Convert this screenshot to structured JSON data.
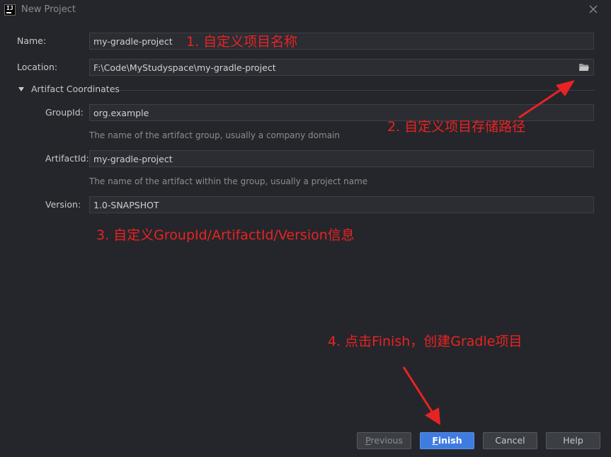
{
  "window": {
    "title": "New Project",
    "app_icon_text": "IJ"
  },
  "form": {
    "name_label": "Name:",
    "name_value": "my-gradle-project",
    "location_label": "Location:",
    "location_value": "F:\\Code\\MyStudyspace\\my-gradle-project",
    "section_title": "Artifact Coordinates",
    "groupid_label": "GroupId:",
    "groupid_value": "org.example",
    "groupid_hint": "The name of the artifact group, usually a company domain",
    "artifactid_label": "ArtifactId:",
    "artifactid_value": "my-gradle-project",
    "artifactid_hint": "The name of the artifact within the group, usually a project name",
    "version_label": "Version:",
    "version_value": "1.0-SNAPSHOT"
  },
  "annotations": {
    "a1": "1. 自定义项目名称",
    "a2": "2. 自定义项目存储路径",
    "a3": "3. 自定义GroupId/ArtifactId/Version信息",
    "a4": "4. 点击Finish，创建Gradle项目"
  },
  "buttons": {
    "previous_mnemonic": "P",
    "previous_rest": "revious",
    "finish_mnemonic": "F",
    "finish_rest": "inish",
    "cancel": "Cancel",
    "help": "Help"
  },
  "icons": {
    "close": "close-icon",
    "folder": "folder-icon",
    "expand": "triangle-down-icon"
  },
  "colors": {
    "background": "#25262b",
    "accent": "#3f7ce0",
    "annotation": "#e82323"
  }
}
